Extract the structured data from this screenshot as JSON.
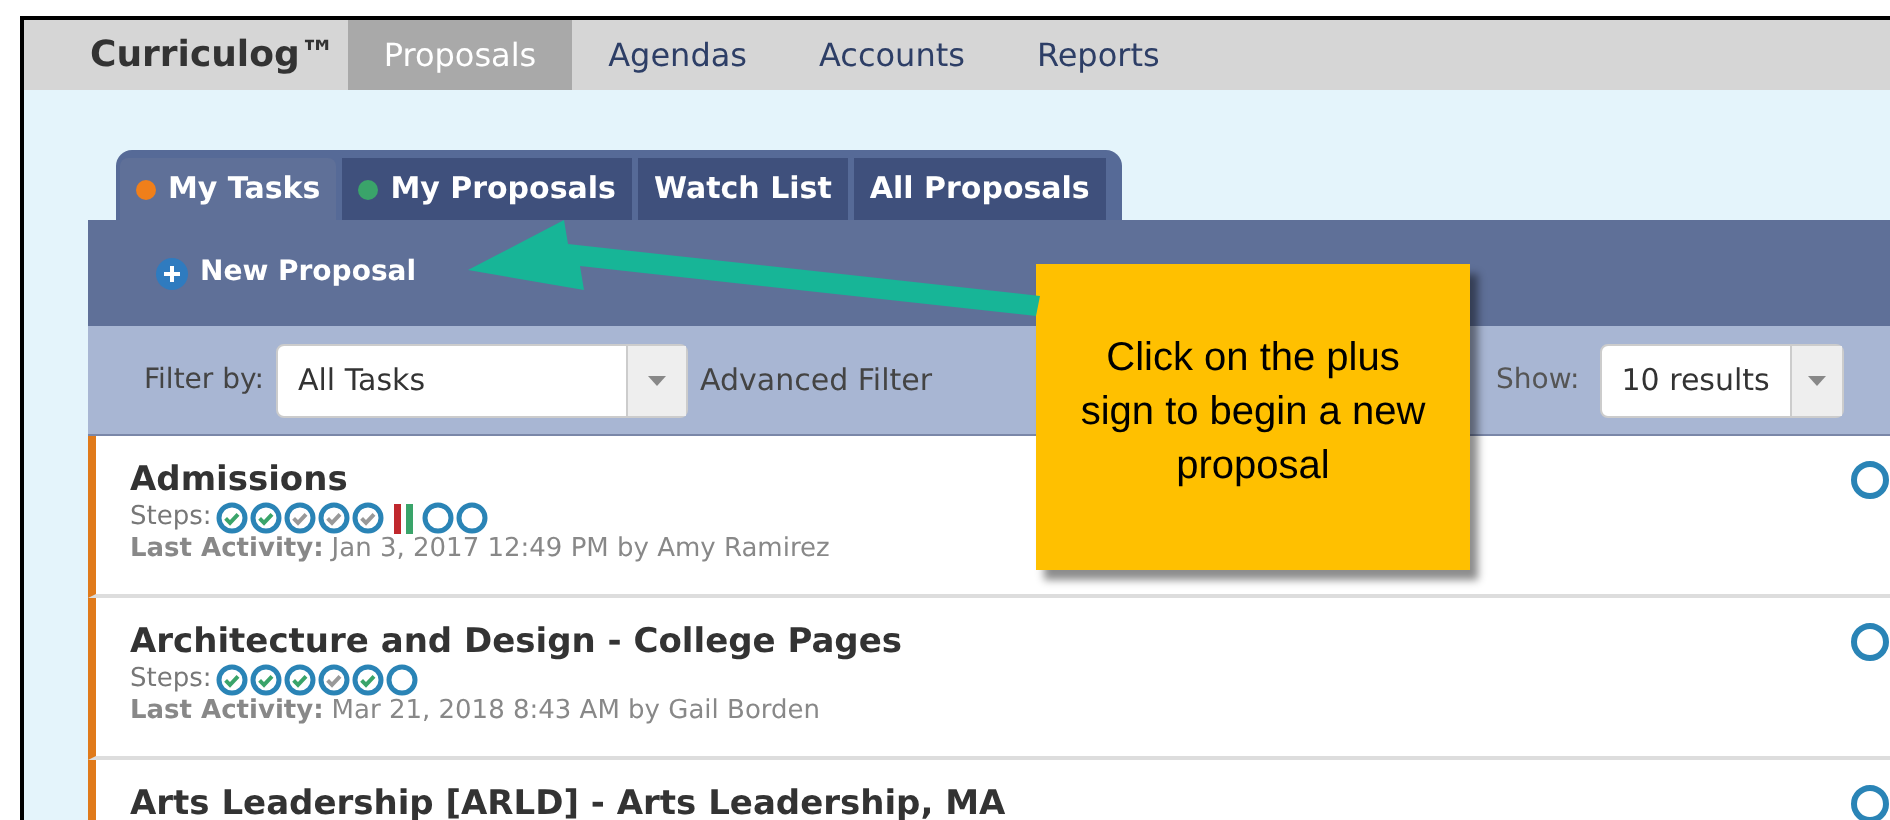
{
  "brand": "Curriculog™",
  "nav": [
    {
      "label": "Proposals",
      "selected": true
    },
    {
      "label": "Agendas",
      "selected": false
    },
    {
      "label": "Accounts",
      "selected": false
    },
    {
      "label": "Reports",
      "selected": false
    }
  ],
  "tabs": [
    {
      "label": "My Tasks",
      "selected": true,
      "color": "#f07f1a"
    },
    {
      "label": "My Proposals",
      "selected": false,
      "color": "#3aa46a"
    },
    {
      "label": "Watch List",
      "selected": false
    },
    {
      "label": "All Proposals",
      "selected": false
    }
  ],
  "new_button": "New Proposal",
  "filter": {
    "label": "Filter by:",
    "value": "All Tasks",
    "advanced": "Advanced Filter",
    "show_label": "Show:",
    "show_value": "10 results"
  },
  "rows": [
    {
      "title": "Admissions",
      "steps_label": "Steps:",
      "steps": [
        {
          "kind": "done"
        },
        {
          "kind": "done"
        },
        {
          "kind": "skipped"
        },
        {
          "kind": "skipped"
        },
        {
          "kind": "skipped"
        },
        {
          "kind": "current"
        },
        {
          "kind": "pending"
        },
        {
          "kind": "pending"
        }
      ],
      "activity_label": "Last Activity:",
      "activity": "Jan 3, 2017 12:49 PM by Amy Ramirez"
    },
    {
      "title": "Architecture and Design - College Pages",
      "steps_label": "Steps:",
      "steps": [
        {
          "kind": "done"
        },
        {
          "kind": "done"
        },
        {
          "kind": "done"
        },
        {
          "kind": "skipped"
        },
        {
          "kind": "done"
        },
        {
          "kind": "pending"
        }
      ],
      "activity_label": "Last Activity:",
      "activity": "Mar 21, 2018 8:43 AM by Gail Borden"
    },
    {
      "title": "Arts Leadership [ARLD] - Arts Leadership, MA"
    }
  ],
  "callout": "Click on the plus sign to begin a new proposal"
}
